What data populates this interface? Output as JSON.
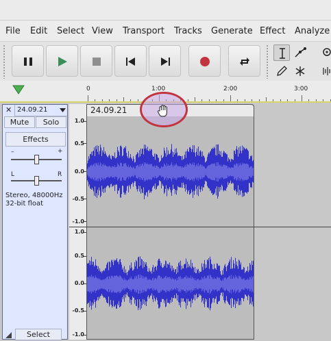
{
  "menu": [
    "File",
    "Edit",
    "Select",
    "View",
    "Transport",
    "Tracks",
    "Generate",
    "Effect",
    "Analyze"
  ],
  "transport": {
    "buttons": [
      {
        "name": "pause-button",
        "icon": "pause-icon"
      },
      {
        "name": "play-button",
        "icon": "play-icon"
      },
      {
        "name": "stop-button",
        "icon": "stop-icon"
      },
      {
        "name": "skip-start-button",
        "icon": "skip-to-start-icon"
      },
      {
        "name": "skip-end-button",
        "icon": "skip-to-end-icon"
      },
      {
        "name": "record-button",
        "icon": "record-icon"
      },
      {
        "name": "loop-button",
        "icon": "loop-icon"
      }
    ],
    "colors": {
      "play": "#3a8f5a",
      "record": "#c0353f",
      "stop": "#8f8f8f"
    }
  },
  "tools": [
    "selection-tool",
    "envelope-tool",
    "zoom-tool",
    "draw-tool",
    "multi-tool"
  ],
  "timeline": {
    "ticks": [
      "0",
      "1:00",
      "2:00",
      "3:00"
    ]
  },
  "track": {
    "name": "24.09.21",
    "mute_label": "Mute",
    "solo_label": "Solo",
    "effects_label": "Effects",
    "gain_minus": "–",
    "gain_plus": "+",
    "pan_left": "L",
    "pan_right": "R",
    "gain_level": 0.5,
    "pan_level": 0.5,
    "info_line1": "Stereo, 48000Hz",
    "info_line2": "32-bit float",
    "select_label": "Select",
    "close_symbol": "✕"
  },
  "clip": {
    "name": "24.09.21"
  },
  "vertical_ruler": {
    "channel1": [
      "1.0",
      "0.5",
      "0.0",
      "-0.5",
      "-1.0"
    ],
    "channel2": [
      "1.0",
      "0.5",
      "0.0",
      "-0.5",
      "-1.0"
    ]
  },
  "waveform_color": "#3232c8",
  "waveform_rms_color": "#6464dc",
  "grab_highlight_color": "#c0353f"
}
